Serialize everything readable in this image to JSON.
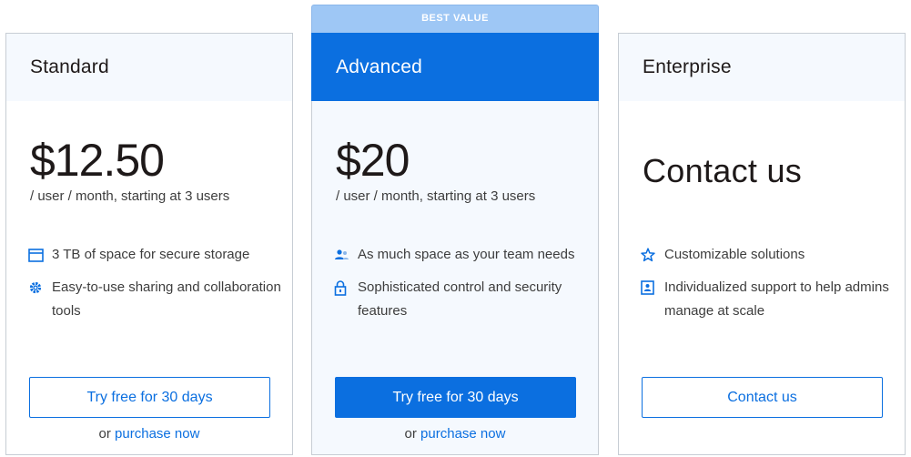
{
  "ribbon": {
    "label": "BEST VALUE"
  },
  "plans": [
    {
      "name": "Standard",
      "price": "$12.50",
      "price_sub": "/ user / month, starting at 3 users",
      "features": [
        {
          "icon": "storage-box-icon",
          "text": "3 TB of space for secure storage"
        },
        {
          "icon": "gear-icon",
          "text": "Easy-to-use sharing and collaboration tools"
        }
      ],
      "button_label": "Try free for 30 days",
      "purchase_prefix": "or",
      "purchase_link": "purchase now"
    },
    {
      "name": "Advanced",
      "price": "$20",
      "price_sub": "/ user / month, starting at 3 users",
      "features": [
        {
          "icon": "team-icon",
          "text": "As much space as your team needs"
        },
        {
          "icon": "lock-icon",
          "text": "Sophisticated control and security features"
        }
      ],
      "button_label": "Try free for 30 days",
      "purchase_prefix": "or",
      "purchase_link": "purchase now"
    },
    {
      "name": "Enterprise",
      "price": "Contact us",
      "features": [
        {
          "icon": "star-icon",
          "text": "Customizable solutions"
        },
        {
          "icon": "support-badge-icon",
          "text": "Individualized support to help admins manage at scale"
        }
      ],
      "button_label": "Contact us"
    }
  ],
  "colors": {
    "accent": "#0b6fe0",
    "ribbon": "#9ec7f5",
    "header_tint": "#f5f9fe",
    "border": "#c7cdd4"
  }
}
